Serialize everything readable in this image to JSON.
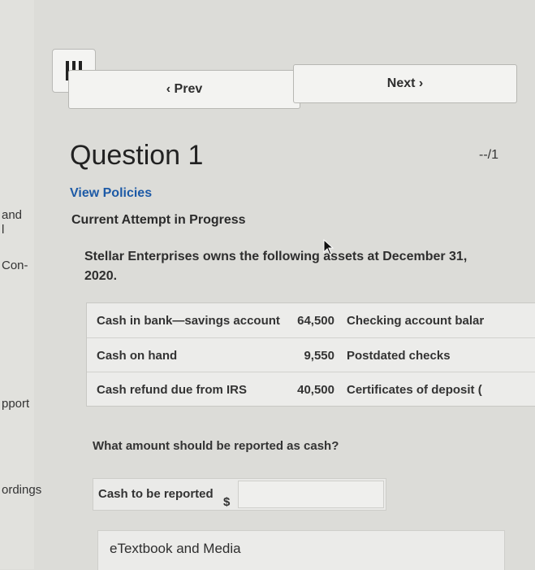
{
  "left_fragments": [
    "and",
    "l",
    "Con-",
    "pport",
    "ordings"
  ],
  "nav": {
    "prev_label": "‹ Prev",
    "next_label": "Next ›"
  },
  "question": {
    "title": "Question 1",
    "score": "--/1",
    "policies_link": "View Policies",
    "attempt_status": "Current Attempt in Progress",
    "text": "Stellar Enterprises owns the following assets at December 31, 2020."
  },
  "assets": [
    {
      "label": "Cash in bank—savings account",
      "value": "64,500",
      "label2": "Checking account balar"
    },
    {
      "label": "Cash on hand",
      "value": "9,550",
      "label2": "Postdated checks"
    },
    {
      "label": "Cash refund due from IRS",
      "value": "40,500",
      "label2": "Certificates of deposit ("
    }
  ],
  "prompt": "What amount should be reported as cash?",
  "answer": {
    "label": "Cash to be reported",
    "currency": "$",
    "value": ""
  },
  "etextbook_label": "eTextbook and Media",
  "colors": {
    "link": "#1d5aa6",
    "background": "#dcdcd8"
  }
}
